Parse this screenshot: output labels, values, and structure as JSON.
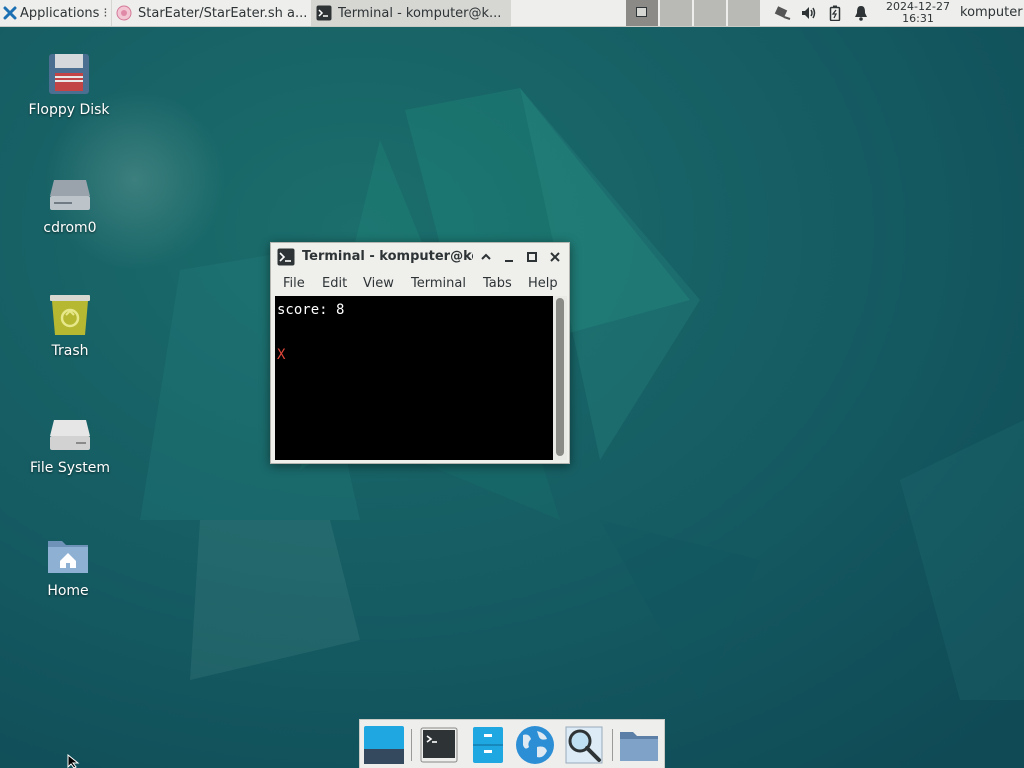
{
  "top_panel": {
    "applications_label": "Applications",
    "tasks": [
      {
        "label": "StarEater/StarEater.sh a..."
      },
      {
        "label": "Terminal - komputer@k..."
      }
    ],
    "clock": {
      "date": "2024-12-27",
      "time": "16:31"
    },
    "user": "komputer",
    "tray_icons": [
      "network-icon",
      "volume-icon",
      "battery-icon",
      "notification-bell-icon"
    ]
  },
  "desktop": {
    "icons": [
      {
        "label": "Floppy Disk",
        "icon": "floppy-disk-icon"
      },
      {
        "label": "cdrom0",
        "icon": "optical-drive-icon"
      },
      {
        "label": "Trash",
        "icon": "trash-icon"
      },
      {
        "label": "File System",
        "icon": "hard-drive-icon"
      },
      {
        "label": "Home",
        "icon": "home-folder-icon"
      }
    ]
  },
  "terminal": {
    "title": "Terminal - komputer@komputer",
    "menu": [
      "File",
      "Edit",
      "View",
      "Terminal",
      "Tabs",
      "Help"
    ],
    "content": {
      "score_line": "score: 8",
      "star_char": "X"
    }
  },
  "dock": {
    "items": [
      "show-desktop-icon",
      "terminal-icon",
      "file-manager-icon",
      "web-browser-icon",
      "app-finder-icon",
      "folder-icon"
    ]
  },
  "colors": {
    "desktop_bg": "#155b62",
    "panel_bg": "#eeeeec",
    "star_red": "#e2473a"
  }
}
